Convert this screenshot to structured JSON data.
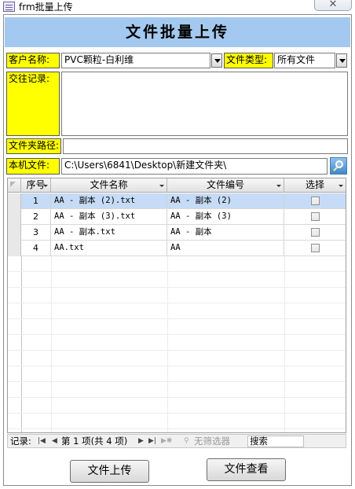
{
  "window": {
    "title": "frm批量上传",
    "close_label": "✕"
  },
  "form": {
    "header_title": "文件批量上传",
    "customer": {
      "label": "客户名称:",
      "value": "PVC颗粒-白利维"
    },
    "file_type": {
      "label": "文件类型:",
      "value": "所有文件"
    },
    "notes": {
      "label": "交往记录:",
      "value": ""
    },
    "folder_path": {
      "label": "文件夹路径:",
      "value": ""
    },
    "local_file": {
      "label": "本机文件:",
      "value": "C:\\Users\\6841\\Desktop\\新建文件夹\\"
    }
  },
  "grid": {
    "columns": [
      "序号",
      "文件名称",
      "文件编号",
      "选择"
    ],
    "rows": [
      {
        "seq": "1",
        "name": "AA - 副本 (2).txt",
        "code": "AA - 副本 (2)",
        "checked": false
      },
      {
        "seq": "2",
        "name": "AA - 副本 (3).txt",
        "code": "AA - 副本 (3)",
        "checked": false
      },
      {
        "seq": "3",
        "name": "AA - 副本.txt",
        "code": "AA - 副本",
        "checked": false
      },
      {
        "seq": "4",
        "name": "AA.txt",
        "code": "AA",
        "checked": false
      }
    ]
  },
  "navigation": {
    "record_label": "记录:",
    "position_text": "第 1 项(共 4 项)",
    "filter_label": "无筛选器",
    "search_label": "搜索"
  },
  "buttons": {
    "upload": "文件上传",
    "view": "文件查看"
  },
  "colors": {
    "label_bg": "#ffff00",
    "header_bg": "#a4c9f0",
    "selected_row": "#c6dbf5"
  }
}
